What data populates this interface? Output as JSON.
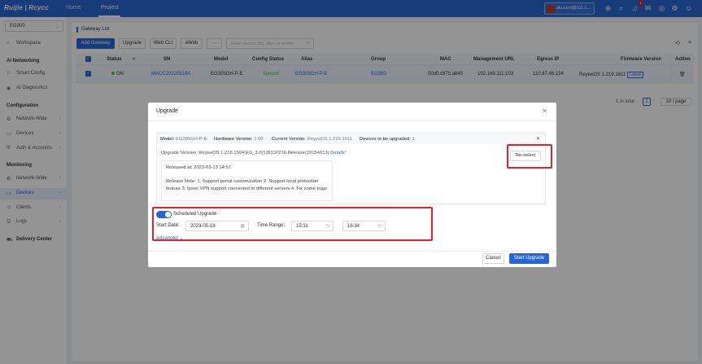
{
  "topbar": {
    "logo": "Ruijie | Rcycc",
    "nav": [
      "Home",
      "Project"
    ],
    "account": "akucent@111.c...",
    "notification_count": "1"
  },
  "sidebar": {
    "device": "EG300",
    "workspace": "Workspace",
    "ai_head": "AI Networking",
    "smart_config": "Smart Config",
    "ai_diag": "AI Diagnostics",
    "config_head": "Configuration",
    "network_wide": "Network-Wide",
    "devices": "Devices",
    "auth": "Auth & Accounts",
    "monitor_head": "Monitoring",
    "mon_network_wide": "Network-Wide",
    "mon_devices": "Devices",
    "clients": "Clients",
    "logs": "Logs",
    "delivery": "Delivery Center"
  },
  "gateway": {
    "title": "Gateway List",
    "buttons": {
      "add": "Add Gateway",
      "upgrade": "Upgrade",
      "webcli": "Web CLI",
      "eweb": "eWeb",
      "more": "···"
    },
    "search_placeholder": "Enter device SN, alias or model",
    "columns": [
      "Status",
      "SN",
      "Model",
      "Config Status",
      "Alias",
      "Group",
      "MAC",
      "Management URL",
      "Egress IP",
      "Firmware Version",
      "Action"
    ],
    "row": {
      "status": "ON",
      "sn": "MACC20220519A",
      "model": "EG305GH-P-E",
      "config_status": "Synced",
      "alias": "EG305GH-P-E",
      "group": "EG300",
      "mac": "00d0.c875.a845",
      "mgmt_url": "192.168.111.103",
      "egress_ip": "110.87.46.194",
      "firmware": "ReyeeOS 1.219.1611",
      "latest": "Latest"
    },
    "pager": {
      "total": "1 in total",
      "page": "1",
      "per_page": "10 / page"
    }
  },
  "modal": {
    "title": "Upgrade",
    "model_label": "Model:",
    "model": "EG305GH-P-E",
    "hw_label": "Hardware Version:",
    "hw": "1.00",
    "cur_label": "Current Version:",
    "cur": "ReyeeOS 1.219.1611",
    "count_label": "Devices to be upgraded:",
    "count": "1",
    "upgrade_version_label": "Upgrade Version:",
    "upgrade_version": "ReyeeOS 1.216.1504;EG_3.0(1)B11P216,Release(10154013)",
    "details": "Details",
    "released_at": "Released at: 2023-03-13 14:57",
    "release_note": "Release Note: 1. Support portal customization 2. Support local protection feature 3. Ipsec VPN support connected to different servers 4. Fix some bugs",
    "reselect": "Re-select",
    "scheduled": "Scheduled Upgrade",
    "start_date_label": "Start Date:",
    "start_date": "2023-05-18",
    "time_range_label": "Time Range:",
    "time_start": "15:31",
    "time_end": "16:34",
    "advanced": "Advanced",
    "cancel": "Cancel",
    "start": "Start Upgrade"
  }
}
